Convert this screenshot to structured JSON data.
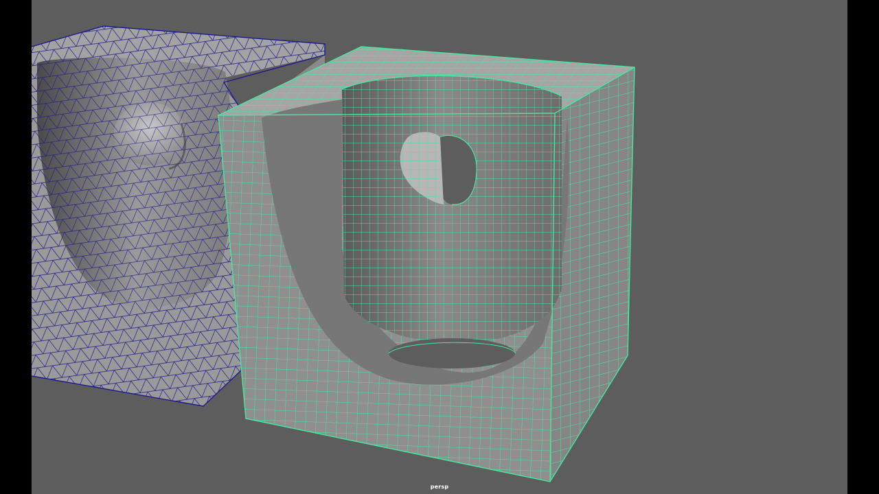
{
  "viewport": {
    "camera_label": "persp",
    "background_color": "#5d5d5d"
  },
  "objects": [
    {
      "name": "triangulated-mesh",
      "wire_color": "#1e1a8c",
      "surface_color": "#9a9a9a",
      "selected": false
    },
    {
      "name": "quad-mesh",
      "wire_color": "#48e6a0",
      "surface_color": "#8d8d8d",
      "selected": true
    }
  ]
}
